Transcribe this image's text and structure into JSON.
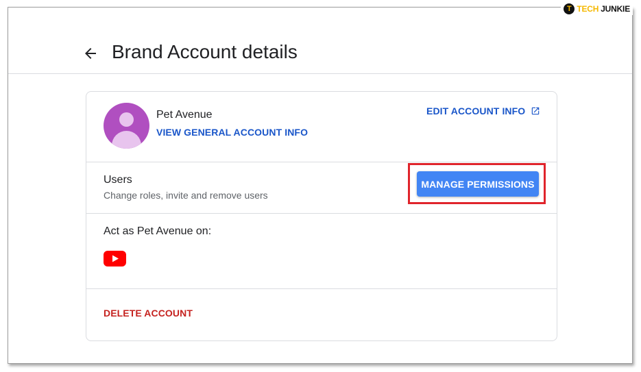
{
  "watermark": {
    "badge": "T",
    "brand_part1": "TECH",
    "brand_part2": "JUNKIE"
  },
  "header": {
    "back_icon": "arrow-left-icon",
    "title": "Brand Account details"
  },
  "account": {
    "name": "Pet Avenue",
    "view_info_label": "VIEW GENERAL ACCOUNT INFO",
    "edit_info_label": "EDIT ACCOUNT INFO",
    "edit_icon": "open-in-new-icon",
    "avatar_icon": "person-avatar-icon"
  },
  "users": {
    "title": "Users",
    "subtitle": "Change roles, invite and remove users",
    "manage_button": "MANAGE PERMISSIONS"
  },
  "act_as": {
    "title": "Act as Pet Avenue on:",
    "service_icon": "youtube-icon"
  },
  "delete": {
    "label": "DELETE ACCOUNT"
  },
  "colors": {
    "link_blue": "#1a56c9",
    "button_blue": "#4285f4",
    "delete_red": "#c5221f",
    "highlight_red": "#e0242b",
    "avatar_purple": "#b04fc0",
    "youtube_red": "#ff0000"
  }
}
